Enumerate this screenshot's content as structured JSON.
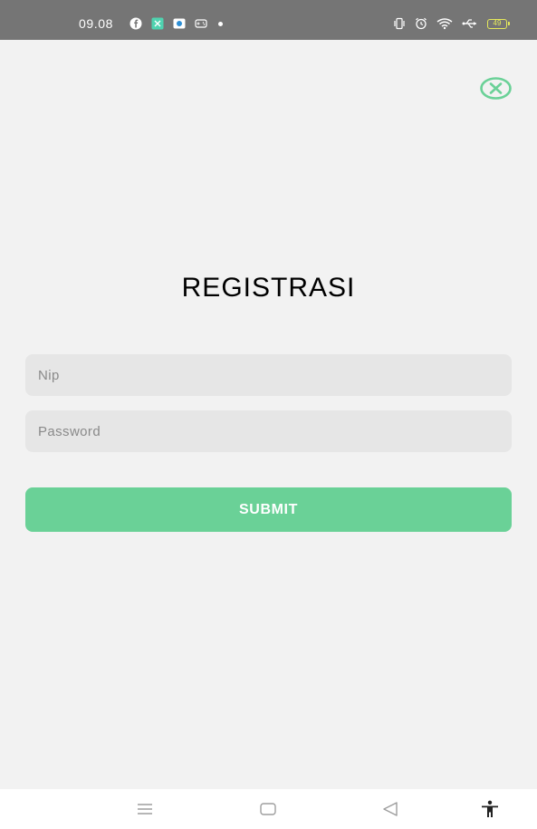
{
  "status_bar": {
    "time": "09.08",
    "battery_level": "49",
    "left_icons": [
      "facebook-icon",
      "cinema-app-icon",
      "video-app-icon",
      "gamepad-icon",
      "notification-dot-icon"
    ],
    "right_icons": [
      "vibrate-icon",
      "alarm-icon",
      "wifi-icon",
      "usb-icon",
      "battery-icon"
    ]
  },
  "close_button": {
    "icon": "close-circle-icon",
    "color": "#6ad197"
  },
  "form": {
    "title": "REGISTRASI",
    "nip_placeholder": "Nip",
    "password_placeholder": "Password",
    "submit_label": "SUBMIT",
    "accent_color": "#6ad197"
  },
  "nav_bar": {
    "buttons": [
      "menu-icon",
      "home-icon",
      "back-icon",
      "accessibility-icon"
    ]
  }
}
